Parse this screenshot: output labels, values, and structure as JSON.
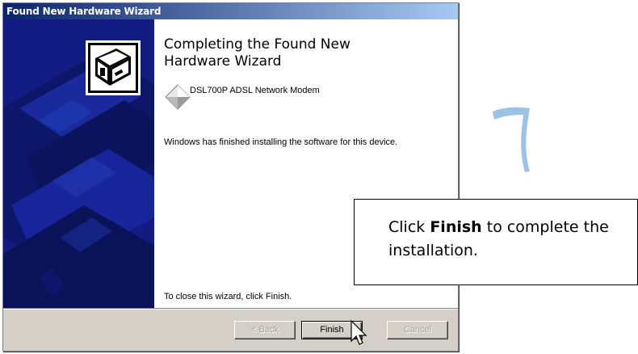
{
  "window": {
    "title": "Found New Hardware Wizard"
  },
  "content": {
    "heading": "Completing the Found New Hardware Wizard",
    "device_name": "DSL700P ADSL Network Modem",
    "finished_message": "Windows has finished installing the software for this device.",
    "close_hint": "To close this wizard, click Finish."
  },
  "buttons": {
    "back": "< Back",
    "finish": "Finish",
    "cancel": "Cancel"
  },
  "callout": {
    "prefix": "Click ",
    "bold": "Finish",
    "suffix": " to complete the  installation."
  },
  "step": {
    "number": "7"
  },
  "colors": {
    "titlebar_start": "#0a246a",
    "titlebar_end": "#a6caf0",
    "side_panel": "#101a7a",
    "step_number": "#9cc3e6"
  },
  "icons": {
    "wizard": "hardware-wizard-icon",
    "device": "device-diamond-icon",
    "cursor": "mouse-pointer-icon"
  }
}
